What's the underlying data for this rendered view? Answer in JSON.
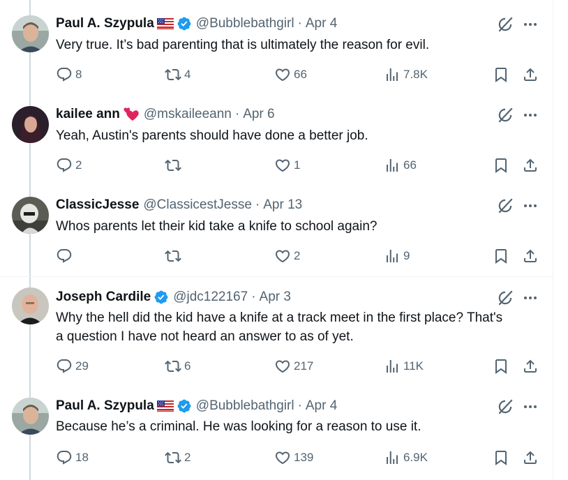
{
  "tweets": [
    {
      "name": "Paul A. Szypula",
      "handle": "@Bubblebathgirl",
      "date": "Apr 4",
      "text": "Very true. It’s bad parenting that is ultimately the reason for evil.",
      "replies": "8",
      "reposts": "4",
      "likes": "66",
      "views": "7.8K",
      "badges": [
        "us-flag",
        "verified"
      ]
    },
    {
      "name": "kailee ann",
      "handle": "@mskaileeann",
      "date": "Apr 6",
      "text": "Yeah, Austin's parents should have done a better job.",
      "replies": "2",
      "reposts": "",
      "likes": "1",
      "views": "66",
      "badges": [
        "two-hearts-emoji"
      ]
    },
    {
      "name": "ClassicJesse",
      "handle": "@ClassicestJesse",
      "date": "Apr 13",
      "text": "Whos parents let their kid take a knife to school again?",
      "replies": "",
      "reposts": "",
      "likes": "2",
      "views": "9",
      "badges": []
    },
    {
      "name": "Joseph Cardile",
      "handle": "@jdc122167",
      "date": "Apr 3",
      "text_line1": "Why the hell did the kid have a knife at a track meet in the first place? That's",
      "text_line2": "a question I have not heard an answer to as of yet.",
      "replies": "29",
      "reposts": "6",
      "likes": "217",
      "views": "11K",
      "badges": [
        "verified"
      ]
    },
    {
      "name": "Paul A. Szypula",
      "handle": "@Bubblebathgirl",
      "date": "Apr 4",
      "text": "Because he’s a criminal. He was looking for a reason to use it.",
      "replies": "18",
      "reposts": "2",
      "likes": "139",
      "views": "6.9K",
      "badges": [
        "us-flag",
        "verified"
      ]
    }
  ],
  "separator": "·",
  "colors": {
    "text": "#0f1419",
    "secondary": "#536471",
    "verified_blue": "#1d9bf0",
    "divider": "#eff3f4",
    "thread_line": "#cfd9de"
  }
}
